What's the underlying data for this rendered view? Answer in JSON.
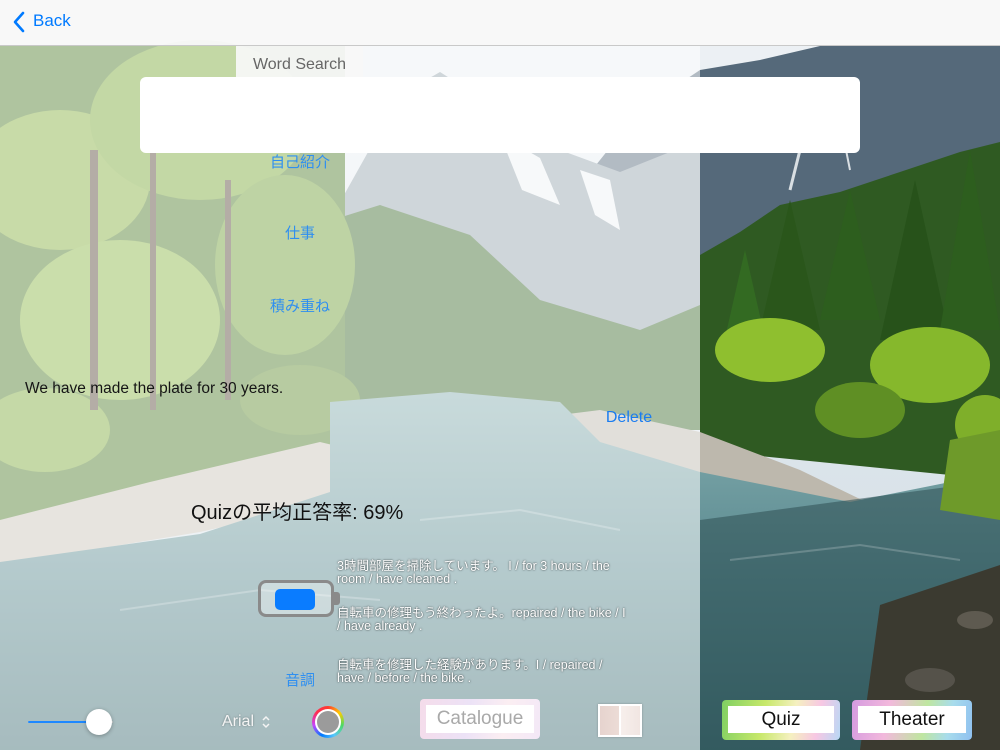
{
  "nav": {
    "back_label": "Back"
  },
  "search": {
    "tab_label": "Word Search",
    "value": ""
  },
  "categories": [
    {
      "label": "自己紹介"
    },
    {
      "label": "仕事"
    },
    {
      "label": "積み重ね"
    },
    {
      "label": "音調"
    }
  ],
  "current_sentence": "We have made the plate for 30 years.",
  "delete_label": "Delete",
  "quiz_stats": {
    "label": "Quizの平均正答率:",
    "value": "69%"
  },
  "sentences": [
    {
      "text": "3時間部屋を掃除しています。 I / for 3 hours / the room / have cleaned ."
    },
    {
      "text": "自転車の修理もう終わったよ。repaired / the bike / I / have already ."
    },
    {
      "text": "自転車を修理した経験があります。I / repaired / have / before / the bike ."
    }
  ],
  "toggle": {
    "on": true
  },
  "controls": {
    "slider_value": 0.83,
    "font_name": "Arial",
    "selected_color": "#9b9b9b",
    "catalogue_label": "Catalogue",
    "quiz_label": "Quiz",
    "theater_label": "Theater"
  },
  "icons": {
    "back": "chevron-left-icon",
    "font_select": "updown-chevron-icon",
    "color": "color-wheel-icon"
  },
  "colors": {
    "accent": "#007aff",
    "link": "#2f8ff0"
  }
}
